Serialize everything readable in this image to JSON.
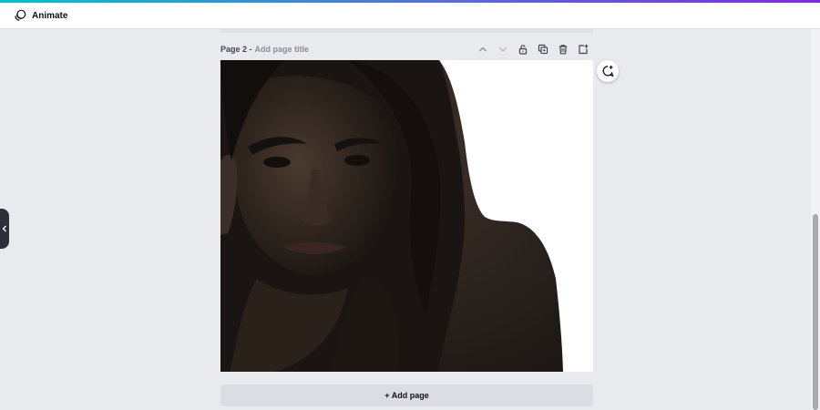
{
  "toolbar": {
    "animate_label": "Animate",
    "animate_icon": "animate-icon"
  },
  "page": {
    "number_label": "Page 2 -",
    "title_placeholder": "Add page title",
    "actions": [
      {
        "name": "move-page-up",
        "icon": "chevron-up-icon"
      },
      {
        "name": "move-page-down",
        "icon": "chevron-down-icon"
      },
      {
        "name": "lock-page",
        "icon": "lock-icon"
      },
      {
        "name": "duplicate-page",
        "icon": "duplicate-icon"
      },
      {
        "name": "delete-page",
        "icon": "trash-icon"
      },
      {
        "name": "add-page-after",
        "icon": "add-page-icon"
      }
    ],
    "image_description_icon": "photo"
  },
  "comment": {
    "icon": "add-comment-icon"
  },
  "add_page": {
    "label": "+ Add page"
  },
  "colors": {
    "workspace_bg": "#e9eaee",
    "toolbar_bg": "#ffffff",
    "accent_gradient_start": "#00c4cc",
    "accent_gradient_end": "#7d2ae8",
    "add_page_bg": "#dcdde2"
  }
}
